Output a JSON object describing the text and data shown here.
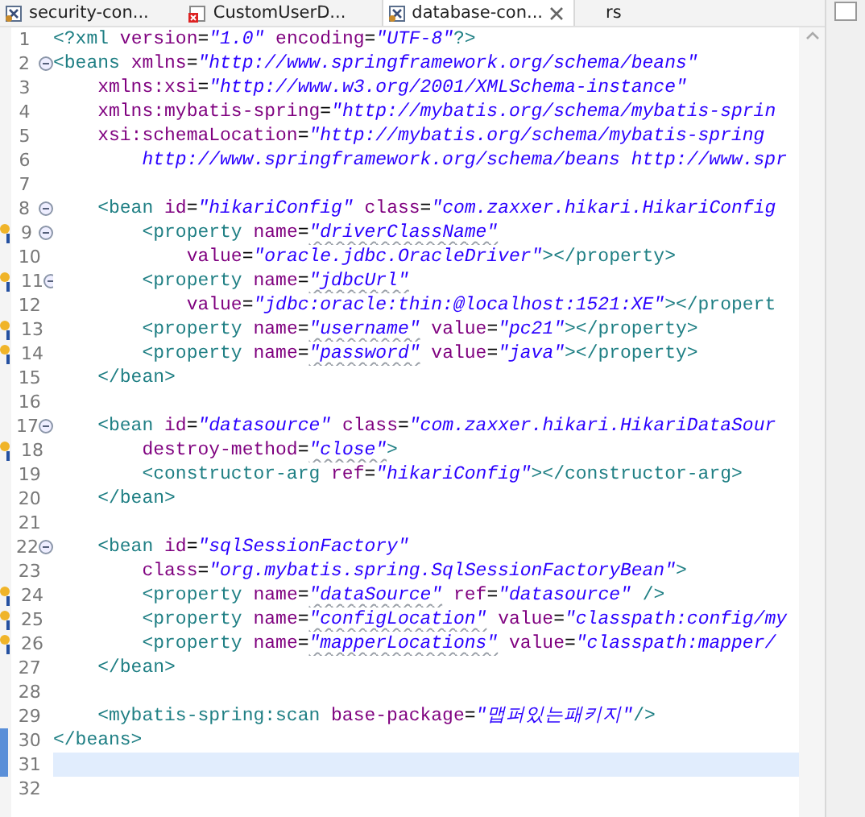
{
  "tabs": [
    {
      "label": "security-con...",
      "kind": "xml",
      "selected": false,
      "closable": false
    },
    {
      "label": "CustomUserD...",
      "kind": "error",
      "selected": false,
      "closable": false
    },
    {
      "label": "database-con...",
      "kind": "xml",
      "selected": true,
      "closable": true
    },
    {
      "label": "rs",
      "kind": "plain",
      "selected": false,
      "closable": false
    }
  ],
  "lines": [
    {
      "number": "1",
      "fold": false,
      "info": false,
      "changed": false,
      "current": false,
      "tokens": [
        {
          "kind": "tag",
          "text": "<?xml "
        },
        {
          "kind": "attr",
          "text": "version"
        },
        {
          "kind": "eq",
          "text": "="
        },
        {
          "kind": "value",
          "text": "\"1.0\""
        },
        {
          "kind": "attr",
          "text": " encoding"
        },
        {
          "kind": "eq",
          "text": "="
        },
        {
          "kind": "value",
          "text": "\"UTF-8\""
        },
        {
          "kind": "tag",
          "text": "?>"
        }
      ]
    },
    {
      "number": "2",
      "fold": true,
      "info": false,
      "changed": false,
      "current": false,
      "tokens": [
        {
          "kind": "tag",
          "text": "<beans "
        },
        {
          "kind": "attr",
          "text": "xmlns"
        },
        {
          "kind": "eq",
          "text": "="
        },
        {
          "kind": "value",
          "text": "\"http://www.springframework.org/schema/beans\""
        }
      ]
    },
    {
      "number": "3",
      "fold": false,
      "info": false,
      "changed": false,
      "current": false,
      "tokens": [
        {
          "kind": "attr",
          "text": "    xmlns:xsi"
        },
        {
          "kind": "eq",
          "text": "="
        },
        {
          "kind": "value",
          "text": "\"http://www.w3.org/2001/XMLSchema-instance\""
        }
      ]
    },
    {
      "number": "4",
      "fold": false,
      "info": false,
      "changed": false,
      "current": false,
      "tokens": [
        {
          "kind": "attr",
          "text": "    xmlns:mybatis-spring"
        },
        {
          "kind": "eq",
          "text": "="
        },
        {
          "kind": "value",
          "text": "\"http://mybatis.org/schema/mybatis-sprin"
        }
      ]
    },
    {
      "number": "5",
      "fold": false,
      "info": false,
      "changed": false,
      "current": false,
      "tokens": [
        {
          "kind": "attr",
          "text": "    xsi:schemaLocation"
        },
        {
          "kind": "eq",
          "text": "="
        },
        {
          "kind": "value",
          "text": "\"http://mybatis.org/schema/mybatis-spring"
        }
      ]
    },
    {
      "number": "6",
      "fold": false,
      "info": false,
      "changed": false,
      "current": false,
      "tokens": [
        {
          "kind": "value",
          "text": "        http://www.springframework.org/schema/beans http://www.spr"
        }
      ]
    },
    {
      "number": "7",
      "fold": false,
      "info": false,
      "changed": false,
      "current": false
    },
    {
      "number": "8",
      "fold": true,
      "info": false,
      "changed": false,
      "current": false,
      "tokens": [
        {
          "kind": "tag",
          "text": "    <bean "
        },
        {
          "kind": "attr",
          "text": "id"
        },
        {
          "kind": "eq",
          "text": "="
        },
        {
          "kind": "value",
          "text": "\"hikariConfig\""
        },
        {
          "kind": "attr",
          "text": " class"
        },
        {
          "kind": "eq",
          "text": "="
        },
        {
          "kind": "value",
          "text": "\"com.zaxxer.hikari.HikariConfig"
        }
      ]
    },
    {
      "number": "9",
      "fold": true,
      "info": true,
      "changed": false,
      "current": false,
      "tokens": [
        {
          "kind": "tag",
          "text": "        <property "
        },
        {
          "kind": "attr",
          "text": "name"
        },
        {
          "kind": "eq",
          "text": "="
        },
        {
          "kind": "value",
          "text": "\"driverClassName\"",
          "spell": true
        }
      ]
    },
    {
      "number": "10",
      "fold": false,
      "info": false,
      "changed": false,
      "current": false,
      "tokens": [
        {
          "kind": "attr",
          "text": "            value"
        },
        {
          "kind": "eq",
          "text": "="
        },
        {
          "kind": "value",
          "text": "\"oracle.jdbc.OracleDriver\""
        },
        {
          "kind": "tag",
          "text": "></property>"
        }
      ]
    },
    {
      "number": "11",
      "fold": true,
      "info": true,
      "changed": false,
      "current": false,
      "tokens": [
        {
          "kind": "tag",
          "text": "        <property "
        },
        {
          "kind": "attr",
          "text": "name"
        },
        {
          "kind": "eq",
          "text": "="
        },
        {
          "kind": "value",
          "text": "\"jdbcUrl\"",
          "spell": true
        }
      ]
    },
    {
      "number": "12",
      "fold": false,
      "info": false,
      "changed": false,
      "current": false,
      "tokens": [
        {
          "kind": "attr",
          "text": "            value"
        },
        {
          "kind": "eq",
          "text": "="
        },
        {
          "kind": "value",
          "text": "\"jdbc:oracle:thin:@localhost:1521:XE\""
        },
        {
          "kind": "tag",
          "text": "></propert"
        }
      ]
    },
    {
      "number": "13",
      "fold": false,
      "info": true,
      "changed": false,
      "current": false,
      "tokens": [
        {
          "kind": "tag",
          "text": "        <property "
        },
        {
          "kind": "attr",
          "text": "name"
        },
        {
          "kind": "eq",
          "text": "="
        },
        {
          "kind": "value",
          "text": "\"username\"",
          "spell": true
        },
        {
          "kind": "attr",
          "text": " value"
        },
        {
          "kind": "eq",
          "text": "="
        },
        {
          "kind": "value",
          "text": "\"pc21\""
        },
        {
          "kind": "tag",
          "text": "></property>"
        }
      ]
    },
    {
      "number": "14",
      "fold": false,
      "info": true,
      "changed": false,
      "current": false,
      "tokens": [
        {
          "kind": "tag",
          "text": "        <property "
        },
        {
          "kind": "attr",
          "text": "name"
        },
        {
          "kind": "eq",
          "text": "="
        },
        {
          "kind": "value",
          "text": "\"password\"",
          "spell": true
        },
        {
          "kind": "attr",
          "text": " value"
        },
        {
          "kind": "eq",
          "text": "="
        },
        {
          "kind": "value",
          "text": "\"java\""
        },
        {
          "kind": "tag",
          "text": "></property>"
        }
      ]
    },
    {
      "number": "15",
      "fold": false,
      "info": false,
      "changed": false,
      "current": false,
      "tokens": [
        {
          "kind": "tag",
          "text": "    </bean>"
        }
      ]
    },
    {
      "number": "16",
      "fold": false,
      "info": false,
      "changed": false,
      "current": false
    },
    {
      "number": "17",
      "fold": true,
      "info": false,
      "changed": false,
      "current": false,
      "tokens": [
        {
          "kind": "tag",
          "text": "    <bean "
        },
        {
          "kind": "attr",
          "text": "id"
        },
        {
          "kind": "eq",
          "text": "="
        },
        {
          "kind": "value",
          "text": "\"datasource\""
        },
        {
          "kind": "attr",
          "text": " class"
        },
        {
          "kind": "eq",
          "text": "="
        },
        {
          "kind": "value",
          "text": "\"com.zaxxer.hikari.HikariDataSour"
        }
      ]
    },
    {
      "number": "18",
      "fold": false,
      "info": true,
      "changed": false,
      "current": false,
      "tokens": [
        {
          "kind": "attr",
          "text": "        destroy-method"
        },
        {
          "kind": "eq",
          "text": "="
        },
        {
          "kind": "value",
          "text": "\"close\"",
          "spell": true
        },
        {
          "kind": "tag",
          "text": ">"
        }
      ]
    },
    {
      "number": "19",
      "fold": false,
      "info": false,
      "changed": false,
      "current": false,
      "tokens": [
        {
          "kind": "tag",
          "text": "        <constructor-arg "
        },
        {
          "kind": "attr",
          "text": "ref"
        },
        {
          "kind": "eq",
          "text": "="
        },
        {
          "kind": "value",
          "text": "\"hikariConfig\""
        },
        {
          "kind": "tag",
          "text": "></constructor-arg>"
        }
      ]
    },
    {
      "number": "20",
      "fold": false,
      "info": false,
      "changed": false,
      "current": false,
      "tokens": [
        {
          "kind": "tag",
          "text": "    </bean>"
        }
      ]
    },
    {
      "number": "21",
      "fold": false,
      "info": false,
      "changed": false,
      "current": false
    },
    {
      "number": "22",
      "fold": true,
      "info": false,
      "changed": false,
      "current": false,
      "tokens": [
        {
          "kind": "tag",
          "text": "    <bean "
        },
        {
          "kind": "attr",
          "text": "id"
        },
        {
          "kind": "eq",
          "text": "="
        },
        {
          "kind": "value",
          "text": "\"sqlSessionFactory\""
        }
      ]
    },
    {
      "number": "23",
      "fold": false,
      "info": false,
      "changed": false,
      "current": false,
      "tokens": [
        {
          "kind": "attr",
          "text": "        class"
        },
        {
          "kind": "eq",
          "text": "="
        },
        {
          "kind": "value",
          "text": "\"org.mybatis.spring.SqlSessionFactoryBean\""
        },
        {
          "kind": "tag",
          "text": ">"
        }
      ]
    },
    {
      "number": "24",
      "fold": false,
      "info": true,
      "changed": false,
      "current": false,
      "tokens": [
        {
          "kind": "tag",
          "text": "        <property "
        },
        {
          "kind": "attr",
          "text": "name"
        },
        {
          "kind": "eq",
          "text": "="
        },
        {
          "kind": "value",
          "text": "\"dataSource\"",
          "spell": true
        },
        {
          "kind": "attr",
          "text": " ref"
        },
        {
          "kind": "eq",
          "text": "="
        },
        {
          "kind": "value",
          "text": "\"datasource\""
        },
        {
          "kind": "tag",
          "text": " />"
        }
      ]
    },
    {
      "number": "25",
      "fold": false,
      "info": true,
      "changed": false,
      "current": false,
      "tokens": [
        {
          "kind": "tag",
          "text": "        <property "
        },
        {
          "kind": "attr",
          "text": "name"
        },
        {
          "kind": "eq",
          "text": "="
        },
        {
          "kind": "value",
          "text": "\"configLocation\"",
          "spell": true
        },
        {
          "kind": "attr",
          "text": " value"
        },
        {
          "kind": "eq",
          "text": "="
        },
        {
          "kind": "value",
          "text": "\"classpath:config/my"
        }
      ]
    },
    {
      "number": "26",
      "fold": false,
      "info": true,
      "changed": false,
      "current": false,
      "tokens": [
        {
          "kind": "tag",
          "text": "        <property "
        },
        {
          "kind": "attr",
          "text": "name"
        },
        {
          "kind": "eq",
          "text": "="
        },
        {
          "kind": "value",
          "text": "\"mapperLocations\"",
          "spell": true
        },
        {
          "kind": "attr",
          "text": " value"
        },
        {
          "kind": "eq",
          "text": "="
        },
        {
          "kind": "value",
          "text": "\"classpath:mapper/"
        }
      ]
    },
    {
      "number": "27",
      "fold": false,
      "info": false,
      "changed": false,
      "current": false,
      "tokens": [
        {
          "kind": "tag",
          "text": "    </bean>"
        }
      ]
    },
    {
      "number": "28",
      "fold": false,
      "info": false,
      "changed": false,
      "current": false
    },
    {
      "number": "29",
      "fold": false,
      "info": false,
      "changed": false,
      "current": false,
      "tokens": [
        {
          "kind": "tag",
          "text": "    <mybatis-spring:scan "
        },
        {
          "kind": "attr",
          "text": "base-package"
        },
        {
          "kind": "eq",
          "text": "="
        },
        {
          "kind": "value",
          "text": "\"맵퍼있는패키지\""
        },
        {
          "kind": "tag",
          "text": "/>"
        }
      ]
    },
    {
      "number": "30",
      "fold": false,
      "info": false,
      "changed": true,
      "current": false,
      "tokens": [
        {
          "kind": "tag",
          "text": "</beans>"
        }
      ]
    },
    {
      "number": "31",
      "fold": false,
      "info": false,
      "changed": true,
      "current": true
    },
    {
      "number": "32",
      "fold": false,
      "info": false,
      "changed": false,
      "current": false
    }
  ]
}
